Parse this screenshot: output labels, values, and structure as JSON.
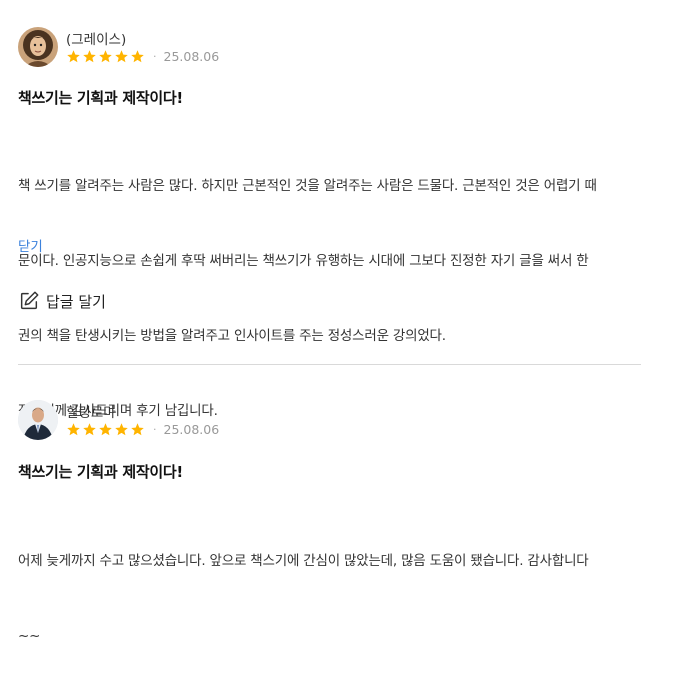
{
  "reviews": [
    {
      "author": "(그레이스)",
      "rating": 5,
      "date": "25.08.06",
      "separator": "·",
      "title": "책쓰기는 기획과 제작이다!",
      "body_lines": [
        "책 쓰기를 알려주는 사람은 많다. 하지만 근본적인 것을 알려주는 사람은 드물다. 근본적인 것은 어렵기 때",
        "문이다. 인공지능으로 손쉽게 후딱 써버리는 책쓰기가 유행하는 시대에 그보다 진정한 자기 글을 써서 한",
        "권의 책을 탄생시키는 방법을 알려주고 인사이트를 주는 정성스러운 강의었다.",
        "작가님께 감사드리며 후기 남깁니다."
      ],
      "close_label": "닫기",
      "reply_label": "답글 달기",
      "avatar_icon": "user-avatar-curly-hair"
    },
    {
      "author": "힐링로마",
      "rating": 5,
      "date": "25.08.06",
      "separator": "·",
      "title": "책쓰기는 기획과 제작이다!",
      "body_lines": [
        "어제 늦게까지 수고 많으셨습니다. 앞으로 책스기에 간심이 많았는데, 많음 도움이 됐습니다. 감사합니다",
        "~~"
      ],
      "avatar_icon": "user-avatar-man-suit"
    }
  ],
  "colors": {
    "star": "#ffb400",
    "link": "#3c82dc",
    "divider": "#d9d9d9"
  },
  "icons": {
    "star": "star-icon",
    "reply": "edit-pencil-icon"
  }
}
